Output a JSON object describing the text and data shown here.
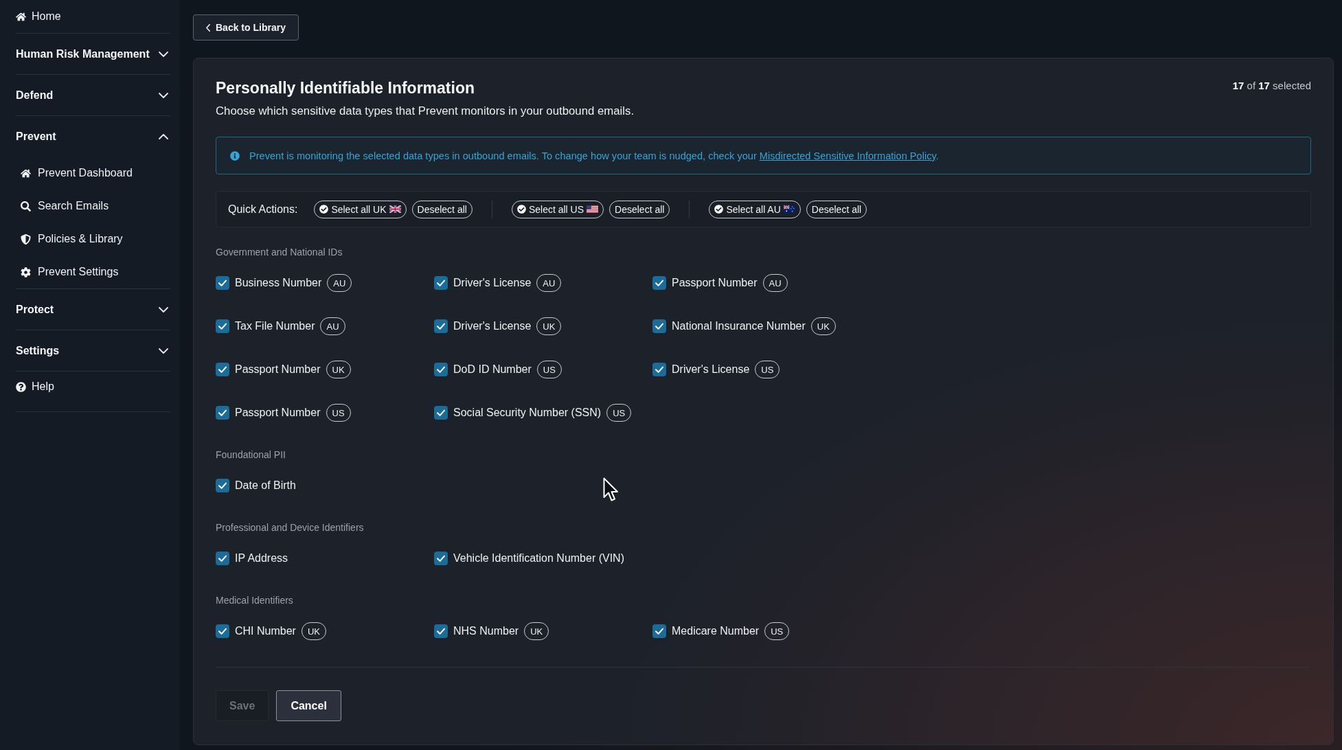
{
  "sidebar": {
    "items": [
      {
        "kind": "link",
        "label": "Home"
      },
      {
        "kind": "section",
        "label": "Human Risk Management",
        "expanded": false
      },
      {
        "kind": "section",
        "label": "Defend",
        "expanded": false
      },
      {
        "kind": "section",
        "label": "Prevent",
        "expanded": true,
        "children": [
          {
            "label": "Prevent Dashboard",
            "selected": false
          },
          {
            "label": "Search Emails",
            "selected": false
          },
          {
            "label": "Policies & Library",
            "selected": false
          },
          {
            "label": "Prevent Settings",
            "selected": false
          }
        ]
      },
      {
        "kind": "section",
        "label": "Protect",
        "expanded": false
      },
      {
        "kind": "section",
        "label": "Settings",
        "expanded": false
      },
      {
        "kind": "link",
        "label": "Help"
      }
    ]
  },
  "back_button": {
    "label": "Back to Library"
  },
  "panel": {
    "title": "Personally Identifiable Information",
    "subtitle": "Choose which sensitive data types that Prevent monitors in your outbound emails.",
    "selection_count": "**17** of **17** selected",
    "notice": {
      "text": "Prevent is monitoring the selected data types in outbound emails. To change how your team is nudged, check your ",
      "link": "Misdirected Sensitive Information Policy",
      "after": "."
    },
    "quick_actions": {
      "label": "Quick Actions:",
      "groups": [
        {
          "select_label": "Select all UK",
          "deselect_label": "Deselect all"
        },
        {
          "select_label": "Select all US",
          "deselect_label": "Deselect all"
        },
        {
          "select_label": "Select all AU",
          "deselect_label": "Deselect all"
        }
      ]
    },
    "categories": [
      {
        "title": "Government and National IDs",
        "items": [
          {
            "label": "Business Number",
            "region": "AU",
            "checked": true
          },
          {
            "label": "Driver's License",
            "region": "AU",
            "checked": true
          },
          {
            "label": "Passport Number",
            "region": "AU",
            "checked": true
          },
          {
            "label": "Tax File Number",
            "region": "AU",
            "checked": true
          },
          {
            "label": "Driver's License",
            "region": "UK",
            "checked": true
          },
          {
            "label": "National Insurance Number",
            "region": "UK",
            "checked": true
          },
          {
            "label": "Passport Number",
            "region": "UK",
            "checked": true
          },
          {
            "label": "DoD ID Number",
            "region": "US",
            "checked": true
          },
          {
            "label": "Driver's License",
            "region": "US",
            "checked": true
          },
          {
            "label": "Passport Number",
            "region": "US",
            "checked": true
          },
          {
            "label": "Social Security Number (SSN)",
            "region": "US",
            "checked": true
          }
        ]
      },
      {
        "title": "Foundational PII",
        "items": [
          {
            "label": "Date of Birth",
            "checked": true
          }
        ]
      },
      {
        "title": "Professional and Device Identifiers",
        "items": [
          {
            "label": "IP Address",
            "checked": true
          },
          {
            "label": "Vehicle Identification Number (VIN)",
            "checked": true
          }
        ]
      },
      {
        "title": "Medical Identifiers",
        "items": [
          {
            "label": "CHI Number",
            "region": "UK",
            "checked": true
          },
          {
            "label": "NHS Number",
            "region": "UK",
            "checked": true
          },
          {
            "label": "Medicare Number",
            "region": "US",
            "checked": true
          }
        ]
      }
    ],
    "actions": [
      {
        "label": "Save",
        "disabled": true
      },
      {
        "label": "Cancel",
        "disabled": false
      }
    ]
  }
}
